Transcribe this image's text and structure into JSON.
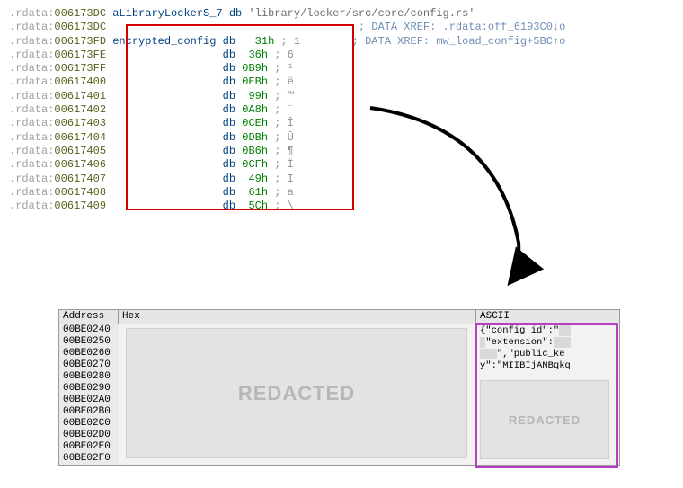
{
  "section": ".rdata",
  "ida_rows": [
    {
      "addr": "006173DC",
      "name": "aLibraryLockerS_7",
      "db": true,
      "str": "'library/locker/src/core/config.rs'"
    },
    {
      "addr": "006173DC",
      "xref": "; DATA XREF: .rdata:off_6193C0↓o"
    },
    {
      "addr": "006173FD",
      "name": "encrypted_config",
      "db": true,
      "hex": "31h",
      "chr": "; 1",
      "xref": "; DATA XREF: mw_load_config+5BC↑o"
    },
    {
      "addr": "006173FE",
      "db": true,
      "hex": "36h",
      "chr": "; 6"
    },
    {
      "addr": "006173FF",
      "db": true,
      "hex": "0B9h",
      "chr": "; ¹"
    },
    {
      "addr": "00617400",
      "db": true,
      "hex": "0EBh",
      "chr": "; ë"
    },
    {
      "addr": "00617401",
      "db": true,
      "hex": "99h",
      "chr": "; ™"
    },
    {
      "addr": "00617402",
      "db": true,
      "hex": "0A8h",
      "chr": "; ¨"
    },
    {
      "addr": "00617403",
      "db": true,
      "hex": "0CEh",
      "chr": "; Î"
    },
    {
      "addr": "00617404",
      "db": true,
      "hex": "0DBh",
      "chr": "; Û"
    },
    {
      "addr": "00617405",
      "db": true,
      "hex": "0B6h",
      "chr": "; ¶"
    },
    {
      "addr": "00617406",
      "db": true,
      "hex": "0CFh",
      "chr": "; Ï"
    },
    {
      "addr": "00617407",
      "db": true,
      "hex": "49h",
      "chr": "; I"
    },
    {
      "addr": "00617408",
      "db": true,
      "hex": "61h",
      "chr": "; a"
    },
    {
      "addr": "00617409",
      "db": true,
      "hex": "5Ch",
      "chr": "; \\"
    }
  ],
  "hexdump": {
    "cols": {
      "addr": "Address",
      "hex": "Hex",
      "asc": "ASCII"
    },
    "addresses": [
      "00BE0240",
      "00BE0250",
      "00BE0260",
      "00BE0270",
      "00BE0280",
      "00BE0290",
      "00BE02A0",
      "00BE02B0",
      "00BE02C0",
      "00BE02D0",
      "00BE02E0",
      "00BE02F0"
    ],
    "ascii_lines": [
      "{\"config_id\":\"",
      "\"extension\":",
      "\",\"public_ke",
      "y\":\"MIIBIjANBqkq"
    ],
    "redacted_label": "REDACTED"
  },
  "colors": {
    "red_box": "#d40000",
    "purple_box": "#b540c4"
  }
}
